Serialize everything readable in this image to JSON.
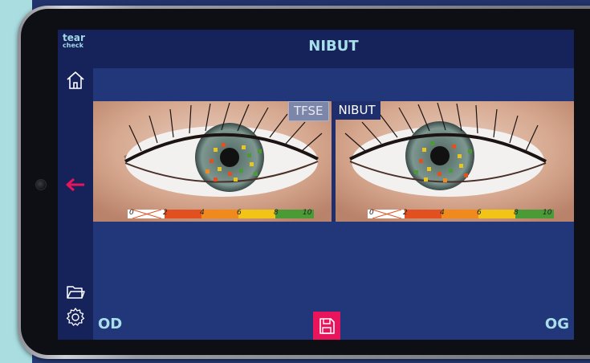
{
  "app": {
    "logo_line1": "tear",
    "logo_line2": "check",
    "title": "NIBUT"
  },
  "sidebar": {
    "icons": [
      "home-icon",
      "arrow-left-icon",
      "folder-icon",
      "gear-icon"
    ]
  },
  "tabs": [
    {
      "label": "TFSE",
      "selected": false
    },
    {
      "label": "NIBUT",
      "selected": true
    }
  ],
  "scale": {
    "labels": [
      "0",
      "2",
      "4",
      "6",
      "8",
      "10"
    ]
  },
  "footer": {
    "left_label": "OD",
    "right_label": "OG",
    "save_icon": "save-icon"
  },
  "colors": {
    "accent": "#e8145c",
    "title": "#a9dfea",
    "sidebar": "#16225a",
    "screen": "#22367a"
  }
}
